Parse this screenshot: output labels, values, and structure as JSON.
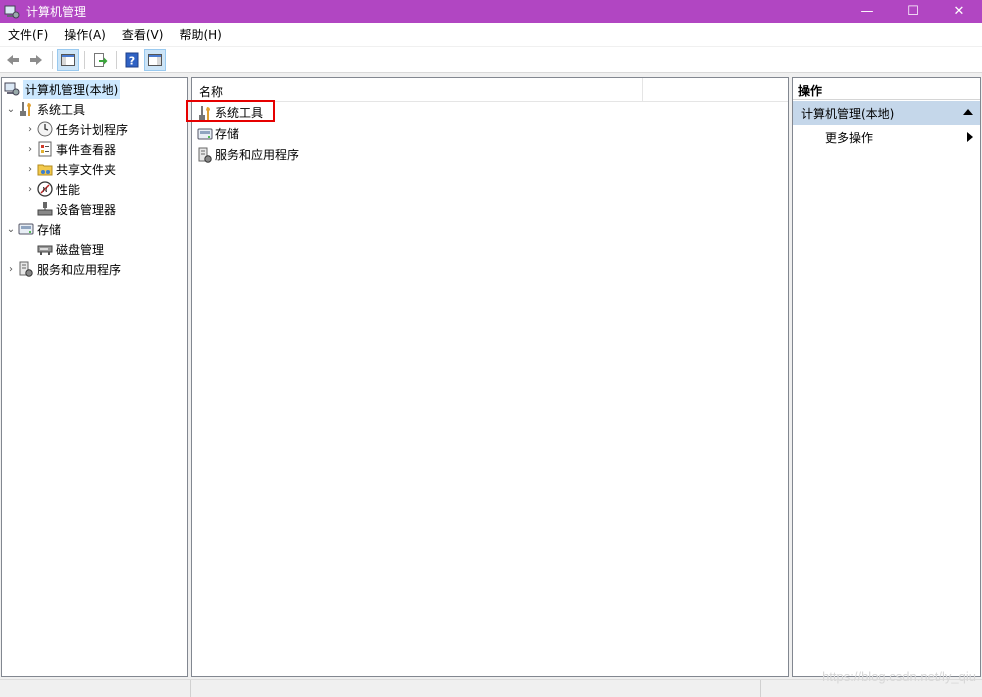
{
  "window": {
    "title": "计算机管理",
    "minimize": "—",
    "maximize": "☐",
    "close": "✕"
  },
  "menu": [
    "文件(F)",
    "操作(A)",
    "查看(V)",
    "帮助(H)"
  ],
  "toolbar": {
    "icons": [
      "back-icon",
      "forward-icon",
      "show-tree-icon",
      "export-icon",
      "help-icon",
      "show-action-pane-icon"
    ]
  },
  "tree": {
    "root": "计算机管理(本地)",
    "system_tools": "系统工具",
    "task_scheduler": "任务计划程序",
    "event_viewer": "事件查看器",
    "shared_folders": "共享文件夹",
    "performance": "性能",
    "device_manager": "设备管理器",
    "storage": "存储",
    "disk_management": "磁盘管理",
    "services_apps": "服务和应用程序"
  },
  "center": {
    "column_name": "名称",
    "items": [
      "系统工具",
      "存储",
      "服务和应用程序"
    ]
  },
  "actions": {
    "title": "操作",
    "section": "计算机管理(本地)",
    "more": "更多操作"
  },
  "watermark": "https://blog.csdn.net/ly_qiu",
  "colors": {
    "titlebar": "#b146c2",
    "highlight": "#e60000",
    "section": "#c5d7ea"
  }
}
